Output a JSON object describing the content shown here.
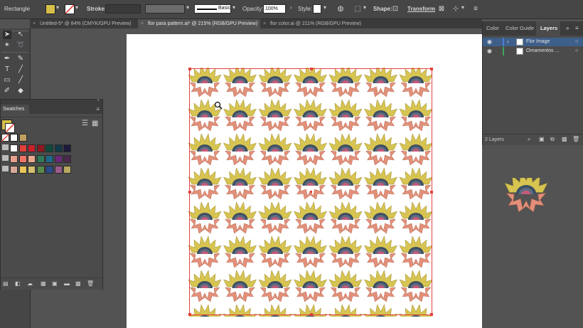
{
  "control_bar": {
    "object_type": "Rectangle",
    "stroke_label": "Stroke:",
    "stroke_weight": "",
    "brush_label": "Basic",
    "opacity_label": "Opacity:",
    "opacity_value": "100%",
    "style_label": "Style:",
    "shape_label": "Shape:",
    "transform_label": "Transform"
  },
  "tabs": [
    {
      "label": "Untitled-5* @ 84% (CMYK/GPU Preview)",
      "active": false
    },
    {
      "label": "flor para pattern.ai* @ 215% (RGB/GPU Preview)",
      "active": true
    },
    {
      "label": "flor color.ai @ 211% (RGB/GPU Preview)",
      "active": false
    }
  ],
  "swatches": {
    "title": "Swatches",
    "row1": [
      "#ffffff",
      "#e0403a",
      "#c8202a",
      "#8c1a20",
      "#0f4a3e",
      "#123a4a",
      "#1b1b3a"
    ],
    "row2": [
      "#e4a08c",
      "#f07468",
      "#e8a88e",
      "#2e7a5a",
      "#1e6a8a",
      "#6a2a7a",
      "#4a2a4a"
    ],
    "row3": [
      "#d8a898",
      "#e8c45a",
      "#d4c070",
      "#5a8a4a",
      "#2a4a8a",
      "#9a5a8a",
      "#b8a860"
    ]
  },
  "layers_panel": {
    "tabs": [
      "Color",
      "Color Guide",
      "Layers"
    ],
    "layers": [
      {
        "name": "Flor Image",
        "color": "#4e7bd6",
        "selected": true
      },
      {
        "name": "Ornamentos ...",
        "color": "#3aa85a",
        "selected": false
      }
    ],
    "count": "2 Layers"
  },
  "colors": {
    "flower_petal": "#d7c451",
    "flower_petal_dark": "#b8a63a",
    "flower_bottom": "#e2907a",
    "flower_center": "#3d4f62",
    "selection": "#e2423b"
  }
}
